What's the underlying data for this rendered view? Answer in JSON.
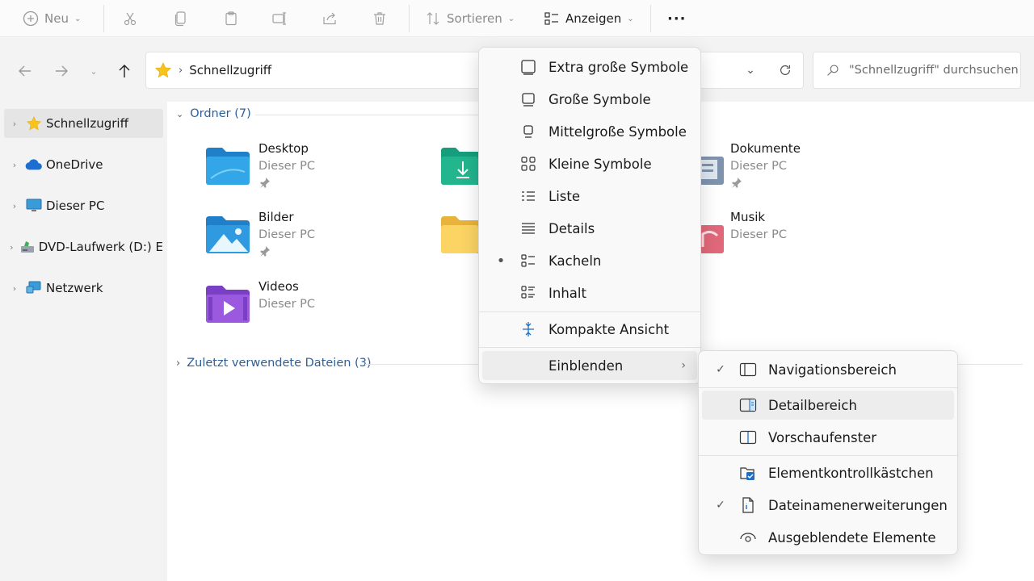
{
  "toolbar": {
    "new_label": "Neu",
    "sort_label": "Sortieren",
    "view_label": "Anzeigen",
    "more_label": "···"
  },
  "address": {
    "path": "Schnellzugriff",
    "search_placeholder": "\"Schnellzugriff\" durchsuchen"
  },
  "sidebar": {
    "items": [
      {
        "label": "Schnellzugriff",
        "icon": "star-icon"
      },
      {
        "label": "OneDrive",
        "icon": "cloud-icon"
      },
      {
        "label": "Dieser PC",
        "icon": "monitor-icon"
      },
      {
        "label": "DVD-Laufwerk (D:) E",
        "icon": "dvd-drive-icon"
      },
      {
        "label": "Netzwerk",
        "icon": "network-icon"
      }
    ]
  },
  "content": {
    "folders_header": "Ordner (7)",
    "recent_header": "Zuletzt verwendete Dateien (3)",
    "folders": [
      {
        "name": "Desktop",
        "sub": "Dieser PC",
        "pinned": true
      },
      {
        "name": "Dokumente",
        "sub": "Dieser PC",
        "pinned": true
      },
      {
        "name": "Bilder",
        "sub": "Dieser PC",
        "pinned": true
      },
      {
        "name": "Musik",
        "sub": "Dieser PC",
        "pinned": false
      },
      {
        "name": "Videos",
        "sub": "Dieser PC",
        "pinned": false
      }
    ]
  },
  "view_menu": {
    "items": [
      {
        "label": "Extra große Symbole",
        "icon": "extra-large-icons-icon"
      },
      {
        "label": "Große Symbole",
        "icon": "large-icons-icon"
      },
      {
        "label": "Mittelgroße Symbole",
        "icon": "medium-icons-icon"
      },
      {
        "label": "Kleine Symbole",
        "icon": "small-icons-icon"
      },
      {
        "label": "Liste",
        "icon": "list-icon"
      },
      {
        "label": "Details",
        "icon": "details-icon"
      },
      {
        "label": "Kacheln",
        "icon": "tiles-icon",
        "selected": true
      },
      {
        "label": "Inhalt",
        "icon": "content-icon"
      },
      {
        "label": "Kompakte Ansicht",
        "icon": "compact-view-icon"
      },
      {
        "label": "Einblenden",
        "icon": "",
        "submenu": true
      }
    ]
  },
  "show_submenu": {
    "items": [
      {
        "label": "Navigationsbereich",
        "checked": true,
        "icon": "navigation-pane-icon"
      },
      {
        "label": "Detailbereich",
        "checked": false,
        "icon": "details-pane-icon"
      },
      {
        "label": "Vorschaufenster",
        "checked": false,
        "icon": "preview-pane-icon"
      },
      {
        "label": "Elementkontrollkästchen",
        "checked": false,
        "icon": "item-checkbox-icon"
      },
      {
        "label": "Dateinamenerweiterungen",
        "checked": true,
        "icon": "file-extension-icon"
      },
      {
        "label": "Ausgeblendete Elemente",
        "checked": false,
        "icon": "hidden-items-icon"
      }
    ]
  },
  "colors": {
    "accent": "#0067c0",
    "group_header": "#2f5f97",
    "star": "#f8c31e"
  }
}
